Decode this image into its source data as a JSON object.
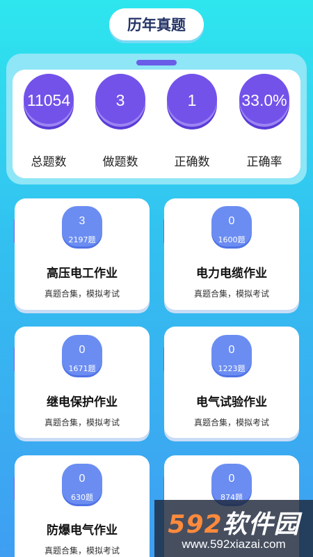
{
  "header": {
    "title": "历年真题"
  },
  "stats": [
    {
      "value": "11054",
      "label": "总题数"
    },
    {
      "value": "3",
      "label": "做题数"
    },
    {
      "value": "1",
      "label": "正确数"
    },
    {
      "value": "33.0%",
      "label": "正确率"
    }
  ],
  "categories": [
    {
      "done": "3",
      "count": "2197题",
      "title": "高压电工作业",
      "subtitle": "真题合集，模拟考试"
    },
    {
      "done": "0",
      "count": "1600题",
      "title": "电力电缆作业",
      "subtitle": "真题合集，模拟考试"
    },
    {
      "done": "0",
      "count": "1671题",
      "title": "继电保护作业",
      "subtitle": "真题合集，模拟考试"
    },
    {
      "done": "0",
      "count": "1223题",
      "title": "电气试验作业",
      "subtitle": "真题合集，模拟考试"
    },
    {
      "done": "0",
      "count": "630题",
      "title": "防爆电气作业",
      "subtitle": "真题合集，模拟考试"
    },
    {
      "done": "0",
      "count": "874题",
      "title": "",
      "subtitle": ""
    }
  ],
  "watermark": {
    "brand_num": "592",
    "brand_text": "软件园",
    "url": "www.592xiazai.com"
  }
}
